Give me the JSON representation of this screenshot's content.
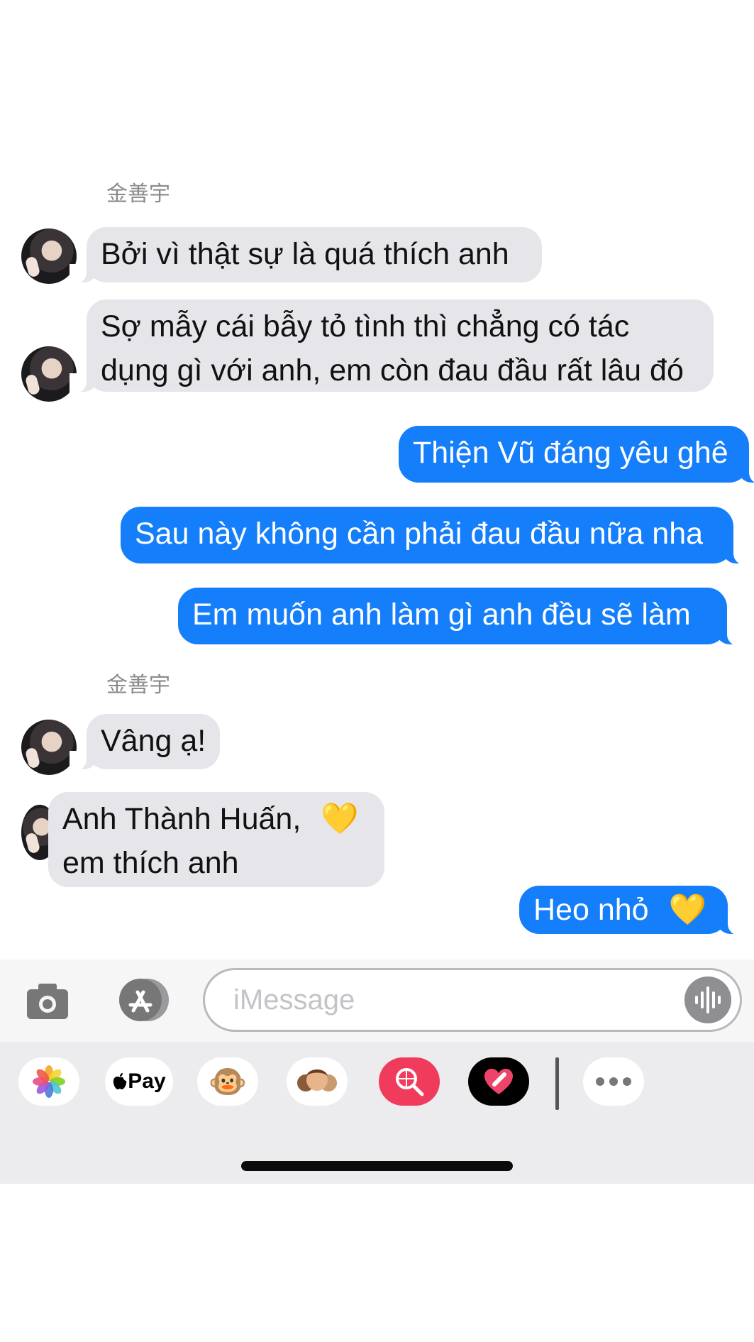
{
  "conversation": {
    "sender_name_1": "金善宇",
    "sender_name_2": "金善宇",
    "messages": [
      {
        "from": "them",
        "text": "Bởi vì thật sự là quá thích anh"
      },
      {
        "from": "them",
        "line1": "Sợ mẫy cái bẫy tỏ tình thì chẳng có tác",
        "line2": "dụng gì với anh, em còn đau đầu rất lâu đó"
      },
      {
        "from": "me",
        "text": "Thiện Vũ đáng yêu ghê"
      },
      {
        "from": "me",
        "text": "Sau này không cần phải đau đầu nữa nha"
      },
      {
        "from": "me",
        "text": "Em muốn anh làm gì anh đều sẽ làm"
      },
      {
        "from": "them",
        "text": "Vâng ạ!"
      },
      {
        "from": "them",
        "line1": "Anh Thành Huấn,",
        "line2": "em thích anh",
        "emoji": "💛"
      },
      {
        "from": "me",
        "text": "Heo nhỏ",
        "emoji": "💛"
      }
    ]
  },
  "composer": {
    "placeholder": "iMessage",
    "icons": [
      "camera-icon",
      "app-store-icon",
      "voice-memo-icon"
    ]
  },
  "app_drawer": {
    "apple_pay_label": "Pay",
    "monkey_emoji": "🐵",
    "icons": [
      "photos-icon",
      "apple-pay-icon",
      "animoji-icon",
      "memoji-icon",
      "web-search-icon",
      "digital-touch-icon",
      "more-icon"
    ]
  },
  "colors": {
    "incoming_bubble": "#e5e5ea",
    "outgoing_bubble": "#157efb",
    "incoming_text": "#111111",
    "outgoing_text": "#ffffff"
  }
}
